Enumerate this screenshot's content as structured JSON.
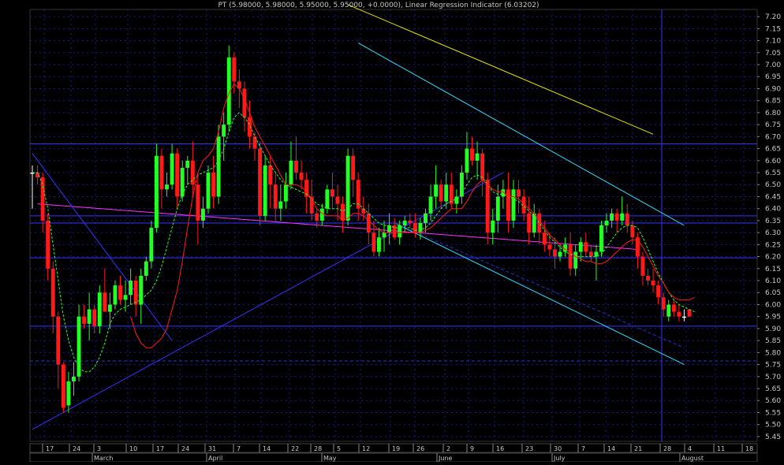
{
  "chart_data": {
    "type": "candlestick",
    "title": "PT (5.98000, 5.98000, 5.95000, 5.95000, +0.0000), Linear Regression Indicator (6.03202)",
    "ylim": [
      5.43,
      7.23
    ],
    "y_ticks": [
      "7.20",
      "7.15",
      "7.10",
      "7.05",
      "7.00",
      "6.95",
      "6.90",
      "6.85",
      "6.80",
      "6.75",
      "6.70",
      "6.65",
      "6.60",
      "6.55",
      "6.50",
      "6.45",
      "6.40",
      "6.35",
      "6.30",
      "6.25",
      "6.20",
      "6.15",
      "6.10",
      "6.05",
      "6.00",
      "5.95",
      "5.90",
      "5.85",
      "5.80",
      "5.75",
      "5.70",
      "5.65",
      "5.60",
      "5.55",
      "5.50",
      "5.45"
    ],
    "x_day_ticks": [
      "17",
      "24",
      "3",
      "10",
      "17",
      "24",
      "31",
      "7",
      "14",
      "22",
      "28",
      "5",
      "12",
      "19",
      "26",
      "2",
      "9",
      "16",
      "23",
      "30",
      "7",
      "14",
      "21",
      "28",
      "4",
      "11",
      "18"
    ],
    "x_month_labels": [
      "March",
      "April",
      "May",
      "June",
      "July",
      "August"
    ],
    "grid": true,
    "candles": [
      {
        "o": 6.55,
        "h": 6.58,
        "l": 6.4,
        "c": 6.55
      },
      {
        "o": 6.55,
        "h": 6.58,
        "l": 6.5,
        "c": 6.53
      },
      {
        "o": 6.53,
        "h": 6.55,
        "l": 6.3,
        "c": 6.35
      },
      {
        "o": 6.35,
        "h": 6.38,
        "l": 6.1,
        "c": 6.15
      },
      {
        "o": 6.15,
        "h": 6.18,
        "l": 5.88,
        "c": 5.95
      },
      {
        "o": 5.95,
        "h": 5.97,
        "l": 5.65,
        "c": 5.75
      },
      {
        "o": 5.75,
        "h": 5.76,
        "l": 5.55,
        "c": 5.57
      },
      {
        "o": 5.58,
        "h": 5.72,
        "l": 5.55,
        "c": 5.68
      },
      {
        "o": 5.68,
        "h": 5.76,
        "l": 5.62,
        "c": 5.7
      },
      {
        "o": 5.7,
        "h": 6.0,
        "l": 5.68,
        "c": 5.95
      },
      {
        "o": 5.95,
        "h": 6.0,
        "l": 5.9,
        "c": 5.92
      },
      {
        "o": 5.92,
        "h": 6.05,
        "l": 5.85,
        "c": 5.98
      },
      {
        "o": 5.98,
        "h": 6.0,
        "l": 5.88,
        "c": 5.91
      },
      {
        "o": 5.91,
        "h": 6.08,
        "l": 5.88,
        "c": 6.05
      },
      {
        "o": 6.05,
        "h": 6.15,
        "l": 6.0,
        "c": 5.97
      },
      {
        "o": 5.97,
        "h": 6.05,
        "l": 5.9,
        "c": 6.0
      },
      {
        "o": 6.0,
        "h": 6.1,
        "l": 5.98,
        "c": 6.08
      },
      {
        "o": 6.08,
        "h": 6.12,
        "l": 6.0,
        "c": 6.02
      },
      {
        "o": 6.02,
        "h": 6.1,
        "l": 5.97,
        "c": 6.04
      },
      {
        "o": 6.04,
        "h": 6.15,
        "l": 6.0,
        "c": 6.1
      },
      {
        "o": 6.1,
        "h": 6.12,
        "l": 5.95,
        "c": 6.0
      },
      {
        "o": 6.0,
        "h": 6.15,
        "l": 5.92,
        "c": 6.12
      },
      {
        "o": 6.12,
        "h": 6.2,
        "l": 6.1,
        "c": 6.18
      },
      {
        "o": 6.18,
        "h": 6.35,
        "l": 6.15,
        "c": 6.32
      },
      {
        "o": 6.32,
        "h": 6.67,
        "l": 6.3,
        "c": 6.62
      },
      {
        "o": 6.62,
        "h": 6.65,
        "l": 6.4,
        "c": 6.48
      },
      {
        "o": 6.48,
        "h": 6.55,
        "l": 6.45,
        "c": 6.5
      },
      {
        "o": 6.5,
        "h": 6.67,
        "l": 6.48,
        "c": 6.63
      },
      {
        "o": 6.63,
        "h": 6.65,
        "l": 6.4,
        "c": 6.45
      },
      {
        "o": 6.45,
        "h": 6.6,
        "l": 6.43,
        "c": 6.57
      },
      {
        "o": 6.57,
        "h": 6.62,
        "l": 6.5,
        "c": 6.6
      },
      {
        "o": 6.6,
        "h": 6.68,
        "l": 6.45,
        "c": 6.5
      },
      {
        "o": 6.5,
        "h": 6.55,
        "l": 6.25,
        "c": 6.35
      },
      {
        "o": 6.35,
        "h": 6.45,
        "l": 6.32,
        "c": 6.4
      },
      {
        "o": 6.4,
        "h": 6.58,
        "l": 6.38,
        "c": 6.55
      },
      {
        "o": 6.55,
        "h": 6.62,
        "l": 6.4,
        "c": 6.45
      },
      {
        "o": 6.45,
        "h": 6.75,
        "l": 6.42,
        "c": 6.7
      },
      {
        "o": 6.7,
        "h": 6.8,
        "l": 6.6,
        "c": 6.75
      },
      {
        "o": 6.75,
        "h": 7.08,
        "l": 6.72,
        "c": 7.03
      },
      {
        "o": 7.03,
        "h": 7.05,
        "l": 6.88,
        "c": 6.93
      },
      {
        "o": 6.93,
        "h": 6.98,
        "l": 6.82,
        "c": 6.9
      },
      {
        "o": 6.9,
        "h": 6.93,
        "l": 6.72,
        "c": 6.78
      },
      {
        "o": 6.78,
        "h": 6.85,
        "l": 6.65,
        "c": 6.7
      },
      {
        "o": 6.7,
        "h": 6.72,
        "l": 6.6,
        "c": 6.65
      },
      {
        "o": 6.65,
        "h": 6.68,
        "l": 6.33,
        "c": 6.37
      },
      {
        "o": 6.37,
        "h": 6.62,
        "l": 6.35,
        "c": 6.58
      },
      {
        "o": 6.58,
        "h": 6.62,
        "l": 6.4,
        "c": 6.5
      },
      {
        "o": 6.5,
        "h": 6.55,
        "l": 6.35,
        "c": 6.4
      },
      {
        "o": 6.4,
        "h": 6.5,
        "l": 6.35,
        "c": 6.43
      },
      {
        "o": 6.43,
        "h": 6.55,
        "l": 6.4,
        "c": 6.5
      },
      {
        "o": 6.5,
        "h": 6.68,
        "l": 6.48,
        "c": 6.6
      },
      {
        "o": 6.6,
        "h": 6.7,
        "l": 6.52,
        "c": 6.55
      },
      {
        "o": 6.55,
        "h": 6.6,
        "l": 6.48,
        "c": 6.52
      },
      {
        "o": 6.52,
        "h": 6.55,
        "l": 6.38,
        "c": 6.45
      },
      {
        "o": 6.45,
        "h": 6.52,
        "l": 6.35,
        "c": 6.38
      },
      {
        "o": 6.38,
        "h": 6.4,
        "l": 6.32,
        "c": 6.35
      },
      {
        "o": 6.35,
        "h": 6.42,
        "l": 6.33,
        "c": 6.4
      },
      {
        "o": 6.4,
        "h": 6.5,
        "l": 6.38,
        "c": 6.48
      },
      {
        "o": 6.48,
        "h": 6.55,
        "l": 6.4,
        "c": 6.45
      },
      {
        "o": 6.45,
        "h": 6.5,
        "l": 6.35,
        "c": 6.42
      },
      {
        "o": 6.42,
        "h": 6.45,
        "l": 6.3,
        "c": 6.35
      },
      {
        "o": 6.35,
        "h": 6.65,
        "l": 6.33,
        "c": 6.62
      },
      {
        "o": 6.62,
        "h": 6.65,
        "l": 6.45,
        "c": 6.52
      },
      {
        "o": 6.52,
        "h": 6.55,
        "l": 6.35,
        "c": 6.4
      },
      {
        "o": 6.4,
        "h": 6.45,
        "l": 6.35,
        "c": 6.38
      },
      {
        "o": 6.38,
        "h": 6.42,
        "l": 6.25,
        "c": 6.3
      },
      {
        "o": 6.3,
        "h": 6.35,
        "l": 6.2,
        "c": 6.22
      },
      {
        "o": 6.22,
        "h": 6.32,
        "l": 6.2,
        "c": 6.28
      },
      {
        "o": 6.28,
        "h": 6.35,
        "l": 6.22,
        "c": 6.3
      },
      {
        "o": 6.3,
        "h": 6.38,
        "l": 6.25,
        "c": 6.33
      },
      {
        "o": 6.33,
        "h": 6.36,
        "l": 6.27,
        "c": 6.28
      },
      {
        "o": 6.28,
        "h": 6.35,
        "l": 6.25,
        "c": 6.33
      },
      {
        "o": 6.33,
        "h": 6.37,
        "l": 6.3,
        "c": 6.35
      },
      {
        "o": 6.35,
        "h": 6.38,
        "l": 6.32,
        "c": 6.34
      },
      {
        "o": 6.34,
        "h": 6.38,
        "l": 6.28,
        "c": 6.3
      },
      {
        "o": 6.3,
        "h": 6.36,
        "l": 6.27,
        "c": 6.34
      },
      {
        "o": 6.34,
        "h": 6.4,
        "l": 6.3,
        "c": 6.38
      },
      {
        "o": 6.38,
        "h": 6.5,
        "l": 6.35,
        "c": 6.45
      },
      {
        "o": 6.45,
        "h": 6.58,
        "l": 6.4,
        "c": 6.5
      },
      {
        "o": 6.5,
        "h": 6.52,
        "l": 6.4,
        "c": 6.43
      },
      {
        "o": 6.43,
        "h": 6.55,
        "l": 6.4,
        "c": 6.5
      },
      {
        "o": 6.5,
        "h": 6.55,
        "l": 6.4,
        "c": 6.42
      },
      {
        "o": 6.42,
        "h": 6.48,
        "l": 6.38,
        "c": 6.45
      },
      {
        "o": 6.45,
        "h": 6.58,
        "l": 6.42,
        "c": 6.55
      },
      {
        "o": 6.55,
        "h": 6.72,
        "l": 6.52,
        "c": 6.65
      },
      {
        "o": 6.65,
        "h": 6.7,
        "l": 6.58,
        "c": 6.6
      },
      {
        "o": 6.6,
        "h": 6.68,
        "l": 6.52,
        "c": 6.63
      },
      {
        "o": 6.63,
        "h": 6.65,
        "l": 6.45,
        "c": 6.52
      },
      {
        "o": 6.52,
        "h": 6.55,
        "l": 6.25,
        "c": 6.3
      },
      {
        "o": 6.3,
        "h": 6.4,
        "l": 6.25,
        "c": 6.35
      },
      {
        "o": 6.35,
        "h": 6.5,
        "l": 6.3,
        "c": 6.45
      },
      {
        "o": 6.45,
        "h": 6.52,
        "l": 6.4,
        "c": 6.48
      },
      {
        "o": 6.48,
        "h": 6.55,
        "l": 6.3,
        "c": 6.35
      },
      {
        "o": 6.35,
        "h": 6.52,
        "l": 6.32,
        "c": 6.48
      },
      {
        "o": 6.48,
        "h": 6.52,
        "l": 6.38,
        "c": 6.45
      },
      {
        "o": 6.45,
        "h": 6.48,
        "l": 6.35,
        "c": 6.38
      },
      {
        "o": 6.38,
        "h": 6.45,
        "l": 6.25,
        "c": 6.3
      },
      {
        "o": 6.3,
        "h": 6.42,
        "l": 6.28,
        "c": 6.38
      },
      {
        "o": 6.38,
        "h": 6.4,
        "l": 6.25,
        "c": 6.3
      },
      {
        "o": 6.3,
        "h": 6.35,
        "l": 6.22,
        "c": 6.25
      },
      {
        "o": 6.25,
        "h": 6.3,
        "l": 6.2,
        "c": 6.23
      },
      {
        "o": 6.23,
        "h": 6.28,
        "l": 6.15,
        "c": 6.2
      },
      {
        "o": 6.2,
        "h": 6.25,
        "l": 6.18,
        "c": 6.22
      },
      {
        "o": 6.22,
        "h": 6.28,
        "l": 6.2,
        "c": 6.25
      },
      {
        "o": 6.25,
        "h": 6.3,
        "l": 6.12,
        "c": 6.15
      },
      {
        "o": 6.15,
        "h": 6.25,
        "l": 6.12,
        "c": 6.22
      },
      {
        "o": 6.22,
        "h": 6.28,
        "l": 6.18,
        "c": 6.26
      },
      {
        "o": 6.26,
        "h": 6.3,
        "l": 6.2,
        "c": 6.22
      },
      {
        "o": 6.22,
        "h": 6.25,
        "l": 6.18,
        "c": 6.2
      },
      {
        "o": 6.2,
        "h": 6.25,
        "l": 6.1,
        "c": 6.22
      },
      {
        "o": 6.22,
        "h": 6.35,
        "l": 6.2,
        "c": 6.33
      },
      {
        "o": 6.33,
        "h": 6.38,
        "l": 6.3,
        "c": 6.35
      },
      {
        "o": 6.35,
        "h": 6.4,
        "l": 6.32,
        "c": 6.38
      },
      {
        "o": 6.38,
        "h": 6.4,
        "l": 6.3,
        "c": 6.35
      },
      {
        "o": 6.35,
        "h": 6.45,
        "l": 6.33,
        "c": 6.38
      },
      {
        "o": 6.38,
        "h": 6.42,
        "l": 6.3,
        "c": 6.33
      },
      {
        "o": 6.33,
        "h": 6.35,
        "l": 6.25,
        "c": 6.28
      },
      {
        "o": 6.28,
        "h": 6.3,
        "l": 6.15,
        "c": 6.2
      },
      {
        "o": 6.2,
        "h": 6.22,
        "l": 6.08,
        "c": 6.12
      },
      {
        "o": 6.12,
        "h": 6.15,
        "l": 6.08,
        "c": 6.1
      },
      {
        "o": 6.1,
        "h": 6.15,
        "l": 6.05,
        "c": 6.08
      },
      {
        "o": 6.08,
        "h": 6.1,
        "l": 6.0,
        "c": 6.03
      },
      {
        "o": 6.03,
        "h": 6.05,
        "l": 5.95,
        "c": 5.98
      },
      {
        "o": 5.95,
        "h": 6.02,
        "l": 5.93,
        "c": 6.0
      },
      {
        "o": 6.0,
        "h": 6.02,
        "l": 5.95,
        "c": 5.97
      },
      {
        "o": 5.97,
        "h": 6.0,
        "l": 5.93,
        "c": 5.95
      },
      {
        "o": 5.95,
        "h": 5.98,
        "l": 5.93,
        "c": 5.95
      },
      {
        "o": 5.98,
        "h": 5.98,
        "l": 5.95,
        "c": 5.95
      }
    ],
    "indicator_line": {
      "name": "Linear Regression Indicator",
      "color": "#ff1a1a",
      "values": [
        null,
        null,
        null,
        null,
        null,
        null,
        null,
        null,
        null,
        null,
        null,
        null,
        null,
        null,
        null,
        null,
        null,
        null,
        null,
        5.95,
        5.88,
        5.84,
        5.82,
        5.82,
        5.84,
        5.86,
        5.9,
        5.98,
        6.06,
        6.18,
        6.32,
        6.45,
        6.55,
        6.6,
        6.62,
        6.65,
        6.72,
        6.82,
        6.88,
        6.92,
        6.9,
        6.86,
        6.8,
        6.74,
        6.7,
        6.66,
        6.62,
        6.58,
        6.54,
        6.5,
        6.5,
        6.5,
        6.49,
        6.47,
        6.44,
        6.4,
        6.38,
        6.37,
        6.37,
        6.37,
        6.35,
        6.36,
        6.38,
        6.38,
        6.37,
        6.35,
        6.33,
        6.31,
        6.3,
        6.3,
        6.3,
        6.3,
        6.3,
        6.3,
        6.3,
        6.3,
        6.31,
        6.32,
        6.34,
        6.36,
        6.38,
        6.4,
        6.4,
        6.4,
        6.43,
        6.47,
        6.5,
        6.52,
        6.5,
        6.48,
        6.47,
        6.47,
        6.45,
        6.45,
        6.44,
        6.42,
        6.4,
        6.38,
        6.35,
        6.32,
        6.29,
        6.27,
        6.25,
        6.23,
        6.22,
        6.2,
        6.19,
        6.18,
        6.18,
        6.17,
        6.17,
        6.18,
        6.2,
        6.22,
        6.24,
        6.26,
        6.27,
        6.27,
        6.24,
        6.2,
        6.16,
        6.12,
        6.09,
        6.05,
        6.03,
        6.02,
        6.02,
        6.02,
        6.03
      ]
    },
    "moving_average_line": {
      "color": "#22ff22",
      "values": [
        6.55,
        6.55,
        6.5,
        6.4,
        6.25,
        6.1,
        5.95,
        5.85,
        5.78,
        5.74,
        5.72,
        5.72,
        5.74,
        5.78,
        5.84,
        5.92,
        5.96,
        5.98,
        5.99,
        6.0,
        6.01,
        6.02,
        6.04,
        6.06,
        6.1,
        6.16,
        6.24,
        6.32,
        6.4,
        6.46,
        6.5,
        6.52,
        6.54,
        6.55,
        6.56,
        6.57,
        6.6,
        6.65,
        6.72,
        6.78,
        6.8,
        6.78,
        6.75,
        6.7,
        6.66,
        6.62,
        6.58,
        6.55,
        6.52,
        6.5,
        6.49,
        6.48,
        6.47,
        6.46,
        6.44,
        6.42,
        6.41,
        6.4,
        6.4,
        6.4,
        6.39,
        6.4,
        6.42,
        6.42,
        6.4,
        6.38,
        6.36,
        6.34,
        6.33,
        6.33,
        6.32,
        6.32,
        6.32,
        6.32,
        6.31,
        6.31,
        6.32,
        6.34,
        6.37,
        6.4,
        6.42,
        6.43,
        6.44,
        6.46,
        6.5,
        6.53,
        6.54,
        6.53,
        6.5,
        6.47,
        6.46,
        6.46,
        6.45,
        6.44,
        6.43,
        6.41,
        6.39,
        6.37,
        6.34,
        6.31,
        6.28,
        6.26,
        6.24,
        6.22,
        6.21,
        6.2,
        6.2,
        6.2,
        6.2,
        6.2,
        6.21,
        6.24,
        6.27,
        6.3,
        6.32,
        6.33,
        6.33,
        6.32,
        6.28,
        6.23,
        6.18,
        6.13,
        6.09,
        6.05,
        6.02,
        6.0,
        5.99,
        5.98,
        5.97
      ]
    },
    "horizontal_lines": [
      {
        "y": 6.67,
        "color": "#3333ff",
        "style": "solid"
      },
      {
        "y": 6.37,
        "color": "#3333ff",
        "style": "solid"
      },
      {
        "y": 6.34,
        "color": "#3333ff",
        "style": "solid"
      },
      {
        "y": 6.195,
        "color": "#3333ff",
        "style": "solid"
      },
      {
        "y": 5.91,
        "color": "#3333ff",
        "style": "solid"
      },
      {
        "y": 5.765,
        "color": "#2233cc",
        "style": "dashed"
      }
    ],
    "trend_lines": [
      {
        "x1": 1,
        "y1": 6.42,
        "x2": 117,
        "y2": 6.23,
        "color": "#ff33ff",
        "style": "solid"
      },
      {
        "x1": 61,
        "y1": 7.25,
        "x2": 120,
        "y2": 6.71,
        "color": "#e6e600",
        "style": "solid"
      },
      {
        "x1": 63,
        "y1": 7.09,
        "x2": 126,
        "y2": 6.33,
        "color": "#33ddff",
        "style": "solid"
      },
      {
        "x1": 70,
        "y1": 6.34,
        "x2": 126,
        "y2": 5.75,
        "color": "#33ddff",
        "style": "solid"
      },
      {
        "x1": 0,
        "y1": 5.48,
        "x2": 91,
        "y2": 6.55,
        "color": "#3333ff",
        "style": "solid"
      },
      {
        "x1": 0,
        "y1": 6.63,
        "x2": 27,
        "y2": 5.85,
        "color": "#3333ff",
        "style": "solid"
      },
      {
        "x1": 70,
        "y1": 6.34,
        "x2": 126,
        "y2": 5.82,
        "color": "#2233cc",
        "style": "dashed"
      }
    ],
    "vertical_lines": [
      {
        "day_tick_index": 23,
        "color": "#3333ff"
      }
    ],
    "colors": {
      "up_candle": "#22ff22",
      "down_candle": "#ff1a1a",
      "doji": "#ffffff",
      "background": "#000000",
      "grid": "#1a1a88",
      "axis_text": "#c8c8c8"
    }
  }
}
